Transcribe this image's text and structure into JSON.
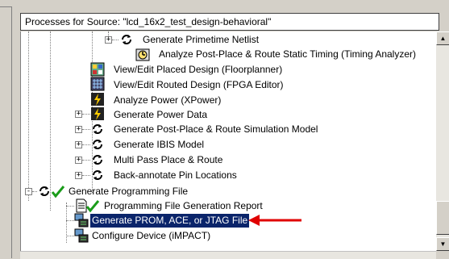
{
  "header": {
    "title": "Processes for Source:  \"lcd_16x2_test_design-behavioral\""
  },
  "tree_items": [
    {
      "label": "Generate Primetime Netlist",
      "icon": "process-cycle-icon",
      "expander": "+"
    },
    {
      "label": "Analyze Post-Place & Route Static Timing (Timing Analyzer)",
      "icon": "timing-analyzer-icon"
    },
    {
      "label": "View/Edit Placed Design (Floorplanner)",
      "icon": "floorplanner-icon"
    },
    {
      "label": "View/Edit Routed Design (FPGA Editor)",
      "icon": "fpga-editor-icon"
    },
    {
      "label": "Analyze Power (XPower)",
      "icon": "xpower-icon"
    },
    {
      "label": "Generate Power Data",
      "icon": "xpower-icon",
      "expander": "+"
    },
    {
      "label": "Generate Post-Place & Route Simulation Model",
      "icon": "process-cycle-icon",
      "expander": "+"
    },
    {
      "label": "Generate IBIS Model",
      "icon": "process-cycle-icon",
      "expander": "+"
    },
    {
      "label": "Multi Pass Place & Route",
      "icon": "process-cycle-icon",
      "expander": "+"
    },
    {
      "label": "Back-annotate Pin Locations",
      "icon": "process-cycle-icon",
      "expander": "+"
    },
    {
      "label": "Generate Programming File",
      "icon": "process-cycle-icon",
      "status": "checkmark-icon",
      "expander": "-"
    },
    {
      "label": "Programming File Generation Report",
      "icon": "report-icon",
      "status": "checkmark-icon"
    },
    {
      "label": "Generate PROM, ACE, or JTAG File",
      "icon": "device-program-icon",
      "selected": true
    },
    {
      "label": "Configure Device (iMPACT)",
      "icon": "device-program-icon"
    }
  ],
  "annotation": {
    "arrow": "red-arrow-icon",
    "color": "#e00000"
  },
  "colors": {
    "selection": "#0a246a",
    "check": "#1a9c1a"
  }
}
